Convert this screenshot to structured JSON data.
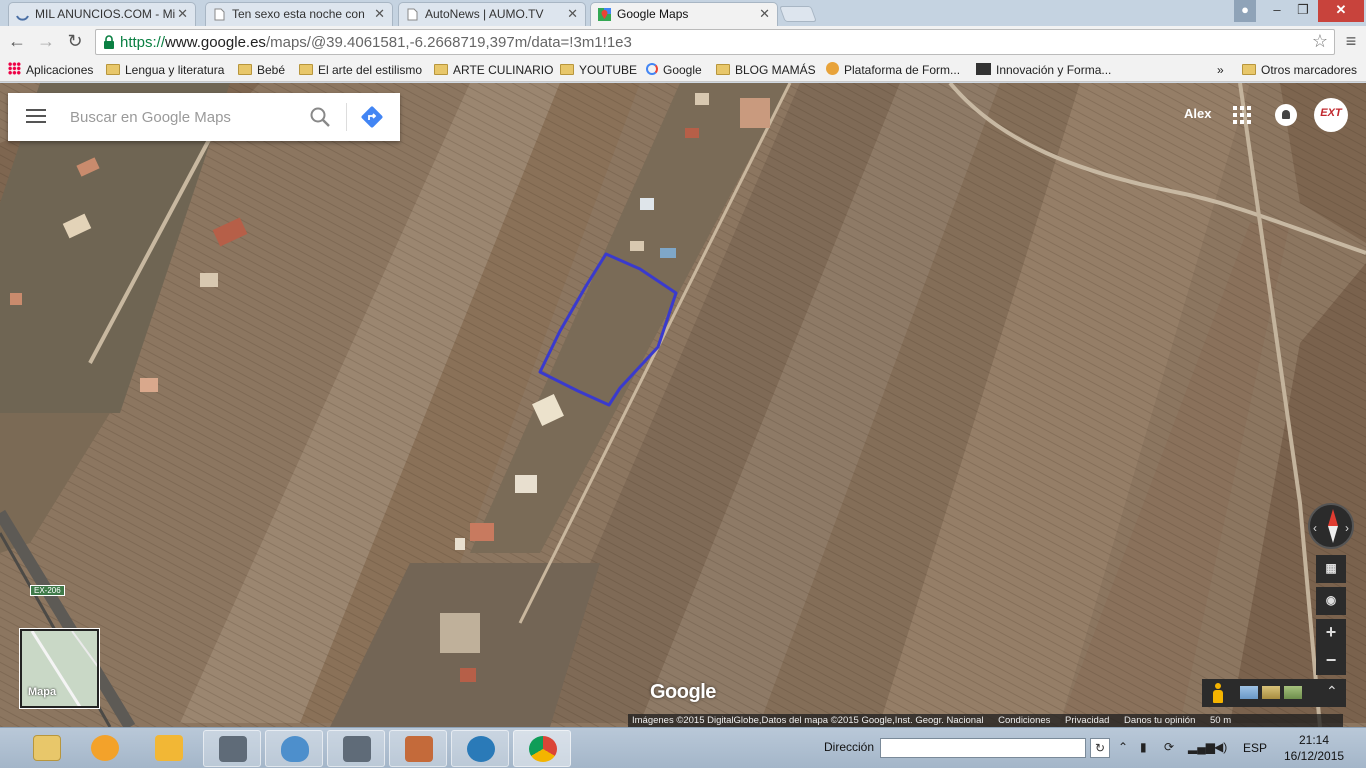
{
  "browser": {
    "tabs": [
      {
        "title": "MIL ANUNCIOS.COM - Mi",
        "active": false
      },
      {
        "title": "Ten sexo esta noche con",
        "active": false
      },
      {
        "title": "AutoNews | AUMO.TV",
        "active": false
      },
      {
        "title": "Google Maps",
        "active": true
      }
    ],
    "close_glyph": "✕",
    "url": {
      "scheme": "https://",
      "host": "www.google.es",
      "path": "/maps/@39.4061581,-6.2668719,397m/data=!3m1!1e3"
    },
    "bookmarks": [
      {
        "label": "Aplicaciones",
        "icon": "apps-icon"
      },
      {
        "label": "Lengua y literatura",
        "icon": "folder-icon"
      },
      {
        "label": "Bebé",
        "icon": "folder-icon"
      },
      {
        "label": "El arte del estilismo",
        "icon": "folder-icon"
      },
      {
        "label": "ARTE CULINARIO",
        "icon": "folder-icon"
      },
      {
        "label": "YOUTUBE",
        "icon": "folder-icon"
      },
      {
        "label": "Google",
        "icon": "google-icon"
      },
      {
        "label": "BLOG MAMÁS",
        "icon": "folder-icon"
      },
      {
        "label": "Plataforma de Form...",
        "icon": "site-icon"
      },
      {
        "label": "Innovación y Forma...",
        "icon": "site-icon"
      }
    ],
    "bookmarks_overflow": "»",
    "other_bookmarks": "Otros marcadores"
  },
  "maps": {
    "search_placeholder": "Buscar en Google Maps",
    "account_name": "Alex",
    "avatar_text": "EXT",
    "minimap_label": "Mapa",
    "road_sign": "EX-206",
    "logo": "Google",
    "compass_left": "‹",
    "compass_right": "›",
    "zoom_in": "+",
    "zoom_out": "−",
    "expand": "⌃",
    "attribution": "Imágenes ©2015 DigitalGlobe,Datos del mapa ©2015 Google,Inst. Geogr. Nacional",
    "terms": "Condiciones",
    "privacy": "Privacidad",
    "feedback": "Danos tu opinión",
    "scale": "50 m",
    "outline_color": "#3a3acd"
  },
  "taskbar": {
    "address_label": "Dirección",
    "refresh_glyph": "↻",
    "language": "ESP",
    "time": "21:14",
    "date": "16/12/2015"
  }
}
